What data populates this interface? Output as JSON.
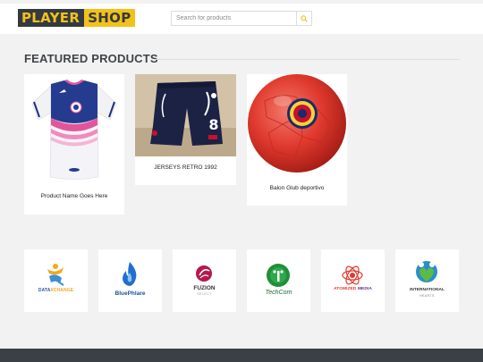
{
  "header": {
    "logo_part1": "PLAYER",
    "logo_part2": "SHOP",
    "search_placeholder": "Search for products",
    "search_icon": "search-icon"
  },
  "featured": {
    "title": "FEATURED PRODUCTS",
    "products": [
      {
        "name": "Product Name Goes Here",
        "image": "jersey"
      },
      {
        "name": "JERSEYS RETRO 1992",
        "image": "shorts"
      },
      {
        "name": "Balon Glub deportivo",
        "image": "ball"
      }
    ]
  },
  "brands": [
    {
      "name": "DATAXCHANGE",
      "prefix": "DATA",
      "suffix": "XCHANGE"
    },
    {
      "name": "BluePhlare"
    },
    {
      "name": "FUZION",
      "tagline": "SELECT"
    },
    {
      "name": "TechCom"
    },
    {
      "name": "ATOMIZED MEDIA",
      "prefix": "ATOMIZED",
      "suffix": "MEDIA"
    },
    {
      "name": "INTERNATIONAL",
      "tagline": "HEARTS"
    }
  ],
  "colors": {
    "accent": "#f2c21b",
    "dark": "#343a40",
    "footer": "#3a4045"
  }
}
